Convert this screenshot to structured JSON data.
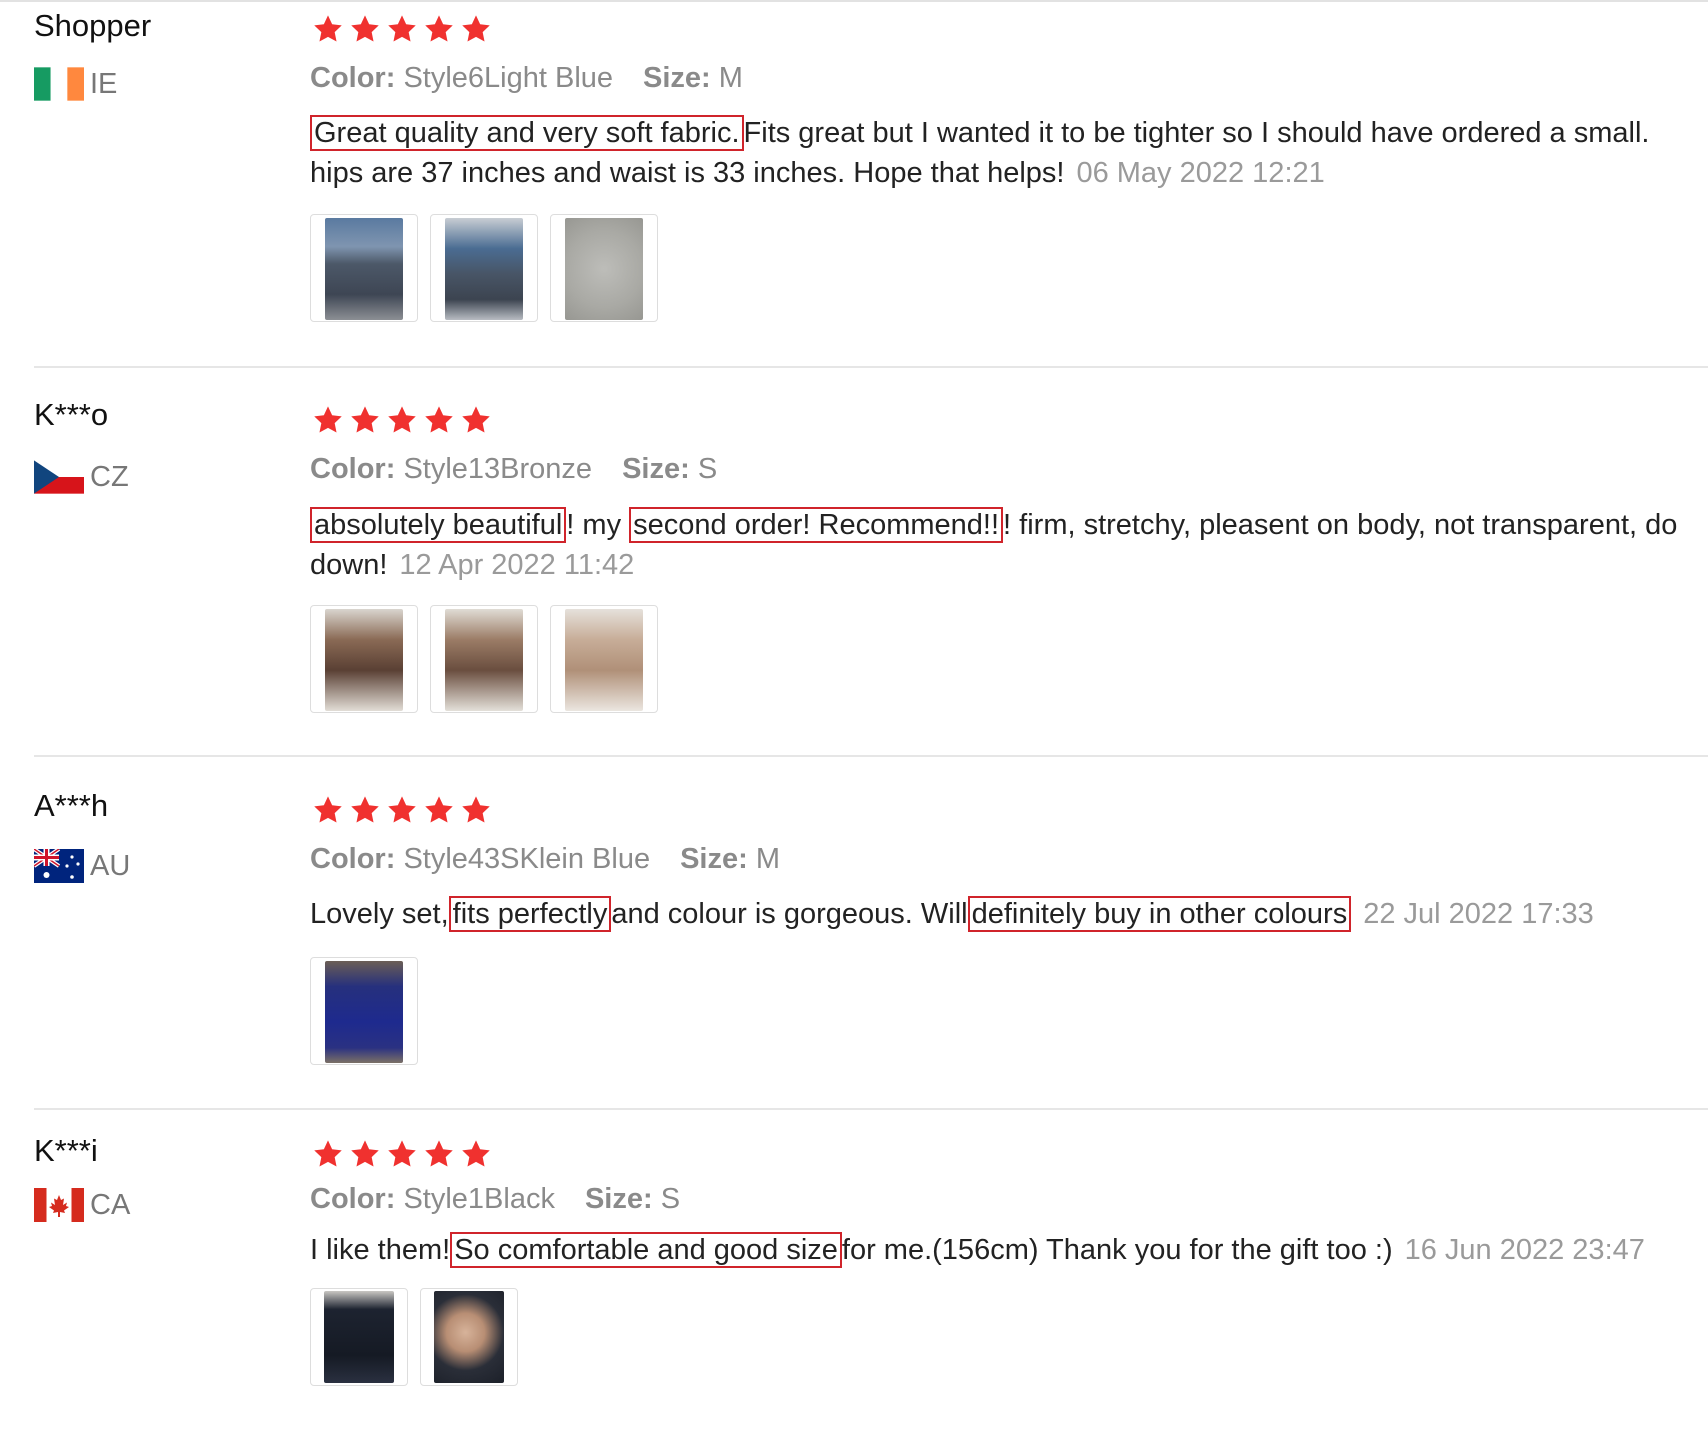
{
  "reviews": [
    {
      "name": "Shopper",
      "country": "IE",
      "flag_icon": "ireland-flag-icon",
      "stars": 5,
      "color_label": "Color:",
      "color_value": "Style6Light Blue",
      "size_label": "Size:",
      "size_value": "M",
      "text_line1_hl1": "Great quality and very soft fabric.",
      "text_line1_rest": "Fits great but I wanted it to be tighter so I should have ordered a small.",
      "text_line2": "hips are 37 inches and waist is 33 inches. Hope that helps!",
      "date": "06 May 2022 12:21",
      "photo_count": 3
    },
    {
      "name": "K***o",
      "country": "CZ",
      "flag_icon": "czech-flag-icon",
      "stars": 5,
      "color_label": "Color:",
      "color_value": "Style13Bronze",
      "size_label": "Size:",
      "size_value": "S",
      "hl1": "absolutely beautiful",
      "t1": "! my",
      "hl2": "second order! Recommend!!",
      "t2": "! firm, stretchy, pleasent on body, not transparent, do",
      "text_line2": "down!",
      "date": "12 Apr 2022 11:42",
      "photo_count": 3
    },
    {
      "name": "A***h",
      "country": "AU",
      "flag_icon": "australia-flag-icon",
      "stars": 5,
      "color_label": "Color:",
      "color_value": "Style43SKlein Blue",
      "size_label": "Size:",
      "size_value": "M",
      "t0": "Lovely set,",
      "hl1": "fits perfectly",
      "t1": "and colour is gorgeous. Will",
      "hl2": "definitely buy in other colours",
      "date": "22 Jul 2022 17:33",
      "photo_count": 1
    },
    {
      "name": "K***i",
      "country": "CA",
      "flag_icon": "canada-flag-icon",
      "stars": 5,
      "color_label": "Color:",
      "color_value": "Style1Black",
      "size_label": "Size:",
      "size_value": "S",
      "t0": "I like them!",
      "hl1": "So comfortable and good size",
      "t1": "for me.(156cm) Thank you for the gift too :)",
      "date": "16 Jun 2022 23:47",
      "photo_count": 2
    }
  ],
  "colors": {
    "star": "#f0312f",
    "highlight_border": "#d0242b",
    "date_text": "#9a9a9a",
    "attr_text": "#8a8a8a"
  }
}
